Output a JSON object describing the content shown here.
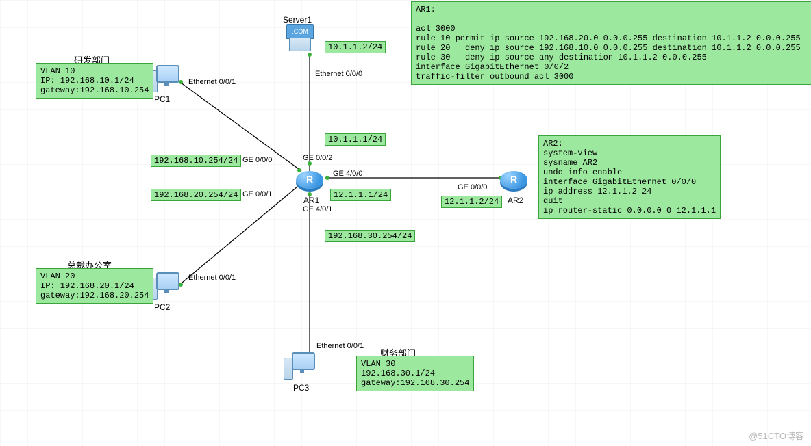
{
  "devices": {
    "server1": {
      "name": "Server1",
      "iconText": ".COM"
    },
    "pc1": {
      "name": "PC1"
    },
    "pc2": {
      "name": "PC2"
    },
    "pc3": {
      "name": "PC3"
    },
    "ar1": {
      "name": "AR1"
    },
    "ar2": {
      "name": "AR2"
    }
  },
  "groups": {
    "rd": {
      "title": "研发部门",
      "body": "VLAN 10\nIP: 192.168.10.1/24\ngateway:192.168.10.254"
    },
    "ceo": {
      "title": "总裁办公室",
      "body": "VLAN 20\nIP: 192.168.20.1/24\ngateway:192.168.20.254"
    },
    "fin": {
      "title": "财务部门",
      "body": "VLAN 30\n192.168.30.1/24\ngateway:192.168.30.254"
    }
  },
  "config": {
    "ar1": "AR1:\n\nacl 3000\nrule 10 permit ip source 192.168.20.0 0.0.0.255 destination 10.1.1.2 0.0.0.255\nrule 20   deny ip source 192.168.10.0 0.0.0.255 destination 10.1.1.2 0.0.0.255\nrule 30   deny ip source any destination 10.1.1.2 0.0.0.255\ninterface GigabitEthernet 0/0/2\ntraffic-filter outbound acl 3000",
    "ar2": "AR2:\nsystem-view\nsysname AR2\nundo info enable\ninterface GigabitEthernet 0/0/0\nip address 12.1.1.2 24\nquit\nip router-static 0.0.0.0 0 12.1.1.1"
  },
  "ipLabels": {
    "server_ip": "10.1.1.2/24",
    "ge002_ip": "10.1.1.1/24",
    "ge000_ip": "192.168.10.254/24",
    "ge001_ip": "192.168.20.254/24",
    "ge401_ip": "192.168.30.254/24",
    "ar1_ge400": "12.1.1.1/24",
    "ar2_ge000": "12.1.1.2/24"
  },
  "ifLabels": {
    "pc1_eth": "Ethernet 0/0/1",
    "pc2_eth": "Ethernet 0/0/1",
    "pc3_eth": "Ethernet 0/0/1",
    "srv_eth": "Ethernet 0/0/0",
    "ar1_ge000": "GE 0/0/0",
    "ar1_ge001": "GE 0/0/1",
    "ar1_ge002": "GE 0/0/2",
    "ar1_ge400": "GE 4/0/0",
    "ar1_ge401": "GE 4/0/1",
    "ar2_ge000": "GE 0/0/0"
  },
  "watermark": "@51CTO博客"
}
